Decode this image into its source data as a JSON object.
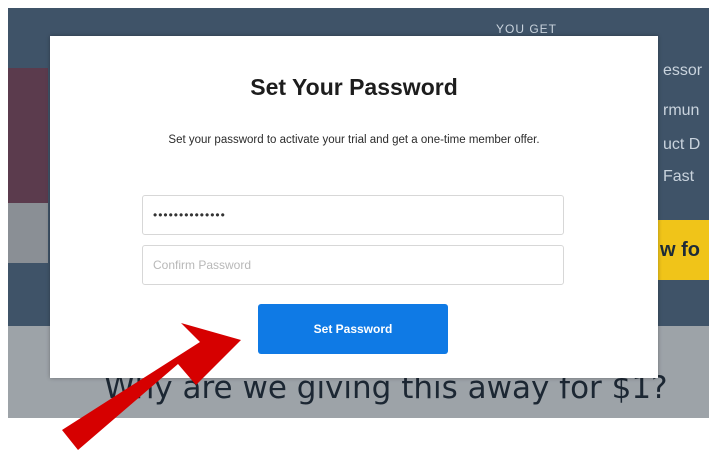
{
  "background": {
    "tab_label": "YOU GET",
    "right_lines": [
      "essor",
      "rmun",
      "uct D",
      "Fast"
    ],
    "cta_label": "w fo",
    "headline": "Why are we giving this away for $1?"
  },
  "modal": {
    "title": "Set Your Password",
    "subtitle": "Set your password to activate your trial and get a one-time member offer.",
    "password_value": "••••••••••••••",
    "confirm_placeholder": "Confirm Password",
    "submit_label": "Set Password"
  },
  "colors": {
    "primary_button": "#0f7ae5",
    "annotation_arrow": "#d60000"
  }
}
